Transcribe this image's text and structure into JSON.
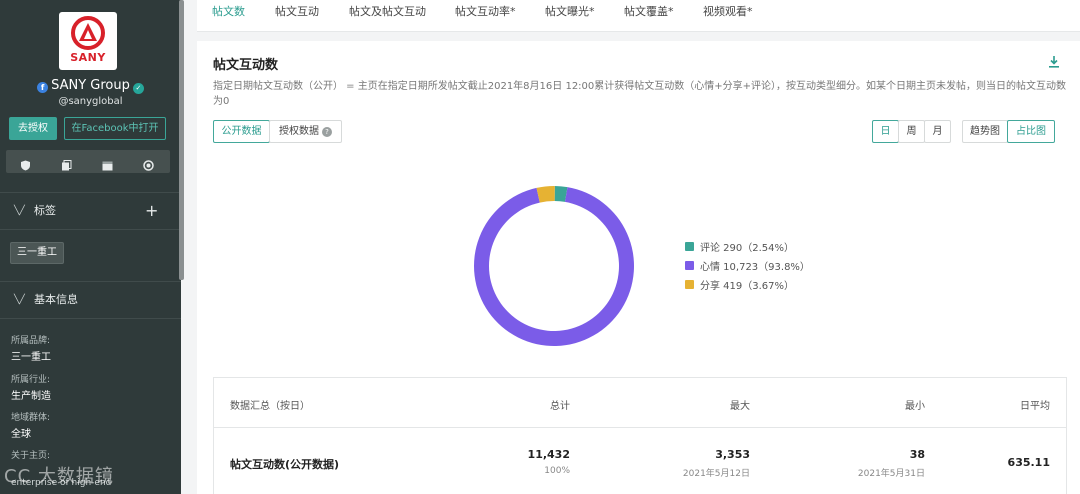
{
  "sidebar": {
    "logo_text": "SANY",
    "profile_name": "SANY Group",
    "handle": "@sanyglobal",
    "auth_button": "去授权",
    "fb_button": "在Facebook中打开",
    "icons": [
      "shield-icon",
      "copy-icon",
      "calendar-icon",
      "target-icon"
    ],
    "tags_title": "标签",
    "tag": "三一重工",
    "basic_title": "基本信息",
    "brand_label": "所属品牌:",
    "brand_value": "三一重工",
    "industry_label": "所属行业:",
    "industry_value": "生产制造",
    "region_label": "地域群体:",
    "region_value": "全球",
    "about_label": "关于主页:",
    "about_text": "enterprise of high-end"
  },
  "tabs": [
    {
      "label": "帖文数",
      "active": true
    },
    {
      "label": "帖文互动",
      "active": false
    },
    {
      "label": "帖文及帖文互动",
      "active": false
    },
    {
      "label": "帖文互动率*",
      "active": false
    },
    {
      "label": "帖文曝光*",
      "active": false
    },
    {
      "label": "帖文覆盖*",
      "active": false
    },
    {
      "label": "视频观看*",
      "active": false
    }
  ],
  "card": {
    "title": "帖文互动数",
    "description": "指定日期帖文互动数（公开） = 主页在指定日期所发帖文截止2021年8月16日 12:00累计获得帖文互动数（心情+分享+评论），按互动类型细分。如某个日期主页未发帖，则当日的帖文互动数为0",
    "data_toggle": [
      {
        "label": "公开数据",
        "active": true
      },
      {
        "label": "授权数据",
        "active": false
      }
    ],
    "period_toggle": [
      {
        "label": "日",
        "active": true
      },
      {
        "label": "周",
        "active": false
      },
      {
        "label": "月",
        "active": false
      }
    ],
    "chart_toggle": [
      {
        "label": "趋势图",
        "active": false
      },
      {
        "label": "占比图",
        "active": true
      }
    ]
  },
  "chart_data": {
    "type": "pie",
    "donut": true,
    "slices": [
      {
        "name": "评论",
        "value": 290,
        "percent": 2.54,
        "label": "评论 290（2.54%）",
        "color": "#3aa597"
      },
      {
        "name": "心情",
        "value": 10723,
        "percent": 93.8,
        "label": "心情 10,723（93.8%）",
        "color": "#7b5ce8"
      },
      {
        "name": "分享",
        "value": 419,
        "percent": 3.67,
        "label": "分享 419（3.67%）",
        "color": "#e6b233"
      }
    ],
    "legend_position": "right"
  },
  "summary": {
    "header_label": "数据汇总（按日）",
    "col_total": "总计",
    "col_max": "最大",
    "col_min": "最小",
    "col_avg": "日平均",
    "row_label": "帖文互动数(公开数据)",
    "total": "11,432",
    "total_pct": "100%",
    "max": "3,353",
    "max_date": "2021年5月12日",
    "min": "38",
    "min_date": "2021年5月31日",
    "avg": "635.11"
  },
  "watermark": "CC 大数据镜"
}
